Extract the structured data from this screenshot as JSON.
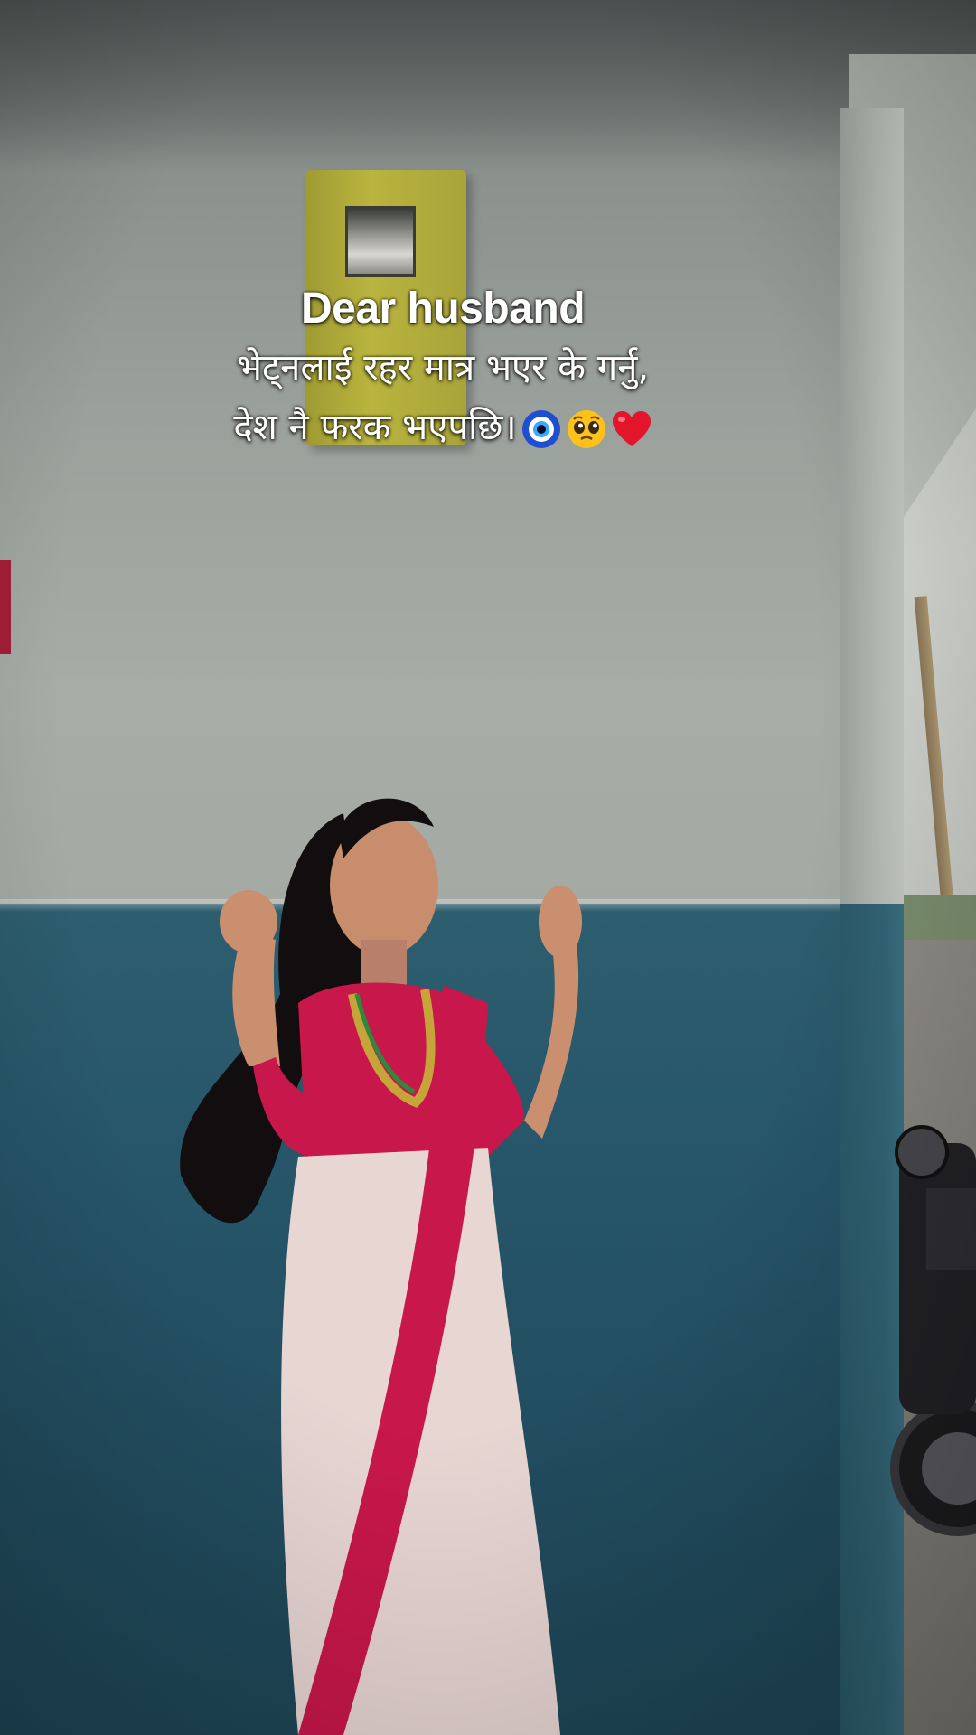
{
  "caption": {
    "title": "Dear husband",
    "line1": "भेट्नलाई रहर मात्र भएर के गर्नु,",
    "line2": "देश नै फरक भएपछि।",
    "emojis": [
      "nazar-amulet-emoji",
      "pleading-face-emoji",
      "red-heart-emoji"
    ]
  },
  "colors": {
    "caption_text": "#ffffff",
    "wall_upper": "#a4a9a3",
    "wall_lower": "#27566a",
    "saree_red": "#c8174a",
    "saree_white": "#e8d6d3"
  }
}
